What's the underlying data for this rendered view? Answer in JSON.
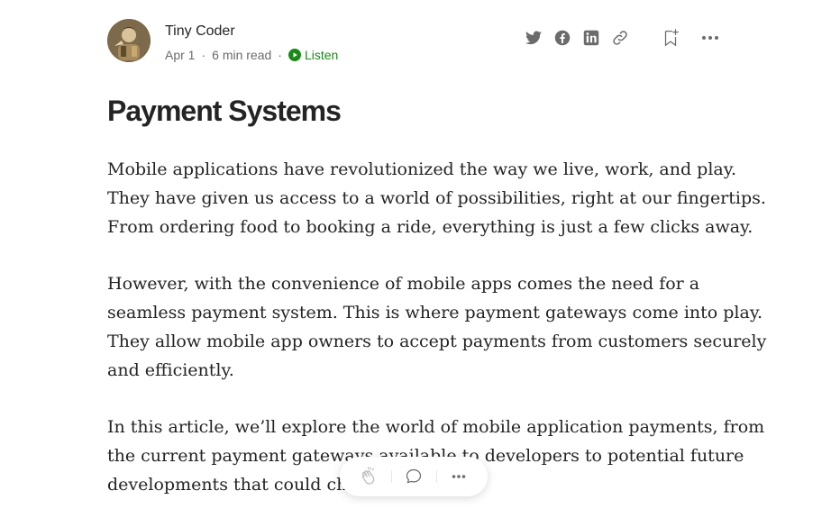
{
  "author": {
    "name": "Tiny Coder",
    "date": "Apr 1",
    "read_time": "6 min read",
    "listen_label": "Listen"
  },
  "header_actions": {
    "icons": [
      "twitter-icon",
      "facebook-icon",
      "linkedin-icon",
      "link-icon",
      "bookmark-add-icon",
      "more-icon"
    ]
  },
  "article": {
    "title": "Payment Systems",
    "paragraphs": [
      {
        "lines": [
          "Mobile applications have revolutionized the way we live, work, and play.",
          "They have given us access to a world of possibilities, right at our fingertips.",
          "From ordering food to booking a ride, everything is just a few clicks away."
        ]
      },
      {
        "lines": [
          "However, with the convenience of mobile apps comes the need for a",
          "seamless payment system. This is where payment gateways come into play.",
          "They allow mobile app owners to accept payments from customers securely",
          "and efficiently."
        ]
      },
      {
        "lines": [
          "In this article, we’ll explore the world of mobile application payments, from",
          "the current payment gateways available to developers to potential future",
          "developments that could change"
        ]
      }
    ]
  },
  "floating_bar": {
    "icons": [
      "clap-icon",
      "comment-icon",
      "more-icon"
    ]
  },
  "colors": {
    "text": "#242424",
    "muted": "#6b6b6b",
    "listen_green": "#1a8917"
  }
}
